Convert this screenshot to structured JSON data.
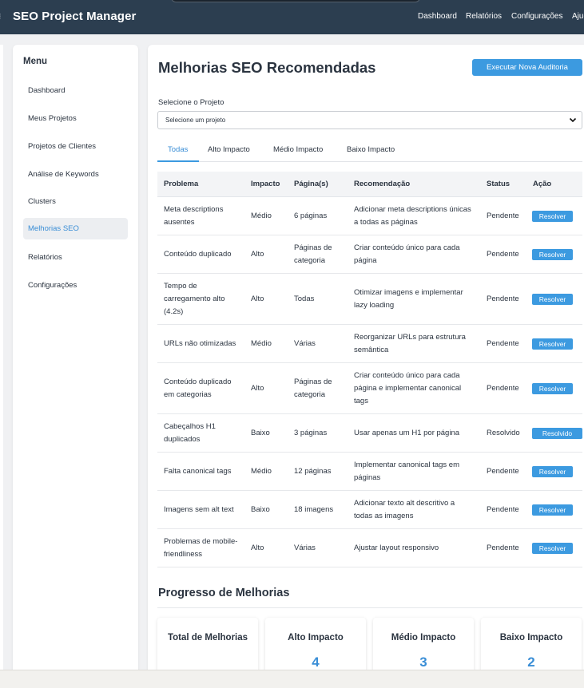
{
  "topbar": {
    "brand": "SEO Project Manager",
    "nav": [
      "Dashboard",
      "Relatórios",
      "Configurações",
      "Ajuda"
    ]
  },
  "sidebar": {
    "title": "Menu",
    "items": [
      {
        "label": "Dashboard"
      },
      {
        "label": "Meus Projetos"
      },
      {
        "label": "Projetos de Clientes"
      },
      {
        "label": "Análise de Keywords"
      },
      {
        "label": "Clusters"
      },
      {
        "label": "Melhorias SEO"
      },
      {
        "label": "Relatórios"
      },
      {
        "label": "Configurações"
      }
    ],
    "active_index": 5
  },
  "main": {
    "title": "Melhorias SEO Recomendadas",
    "run_audit_label": "Executar Nova Auditoria",
    "project_select": {
      "label": "Selecione o Projeto",
      "value": "Selecione um projeto"
    },
    "tabs": [
      "Todas",
      "Alto Impacto",
      "Médio Impacto",
      "Baixo Impacto"
    ],
    "active_tab": 0,
    "table": {
      "headers": [
        "Problema",
        "Impacto",
        "Página(s)",
        "Recomendação",
        "Status",
        "Ação"
      ],
      "rows": [
        {
          "problem": "Meta descriptions ausentes",
          "impact": "Médio",
          "pages": "6 páginas",
          "recommendation": "Adicionar meta descriptions únicas a todas as páginas",
          "status": "Pendente",
          "action": "Resolver"
        },
        {
          "problem": "Conteúdo duplicado",
          "impact": "Alto",
          "pages": "Páginas de categoria",
          "recommendation": "Criar conteúdo único para cada página",
          "status": "Pendente",
          "action": "Resolver"
        },
        {
          "problem": "Tempo de carregamento alto (4.2s)",
          "impact": "Alto",
          "pages": "Todas",
          "recommendation": "Otimizar imagens e implementar lazy loading",
          "status": "Pendente",
          "action": "Resolver"
        },
        {
          "problem": "URLs não otimizadas",
          "impact": "Médio",
          "pages": "Várias",
          "recommendation": "Reorganizar URLs para estrutura semântica",
          "status": "Pendente",
          "action": "Resolver"
        },
        {
          "problem": "Conteúdo duplicado em categorias",
          "impact": "Alto",
          "pages": "Páginas de categoria",
          "recommendation": "Criar conteúdo único para cada página e implementar canonical tags",
          "status": "Pendente",
          "action": "Resolver"
        },
        {
          "problem": "Cabeçalhos H1 duplicados",
          "impact": "Baixo",
          "pages": "3 páginas",
          "recommendation": "Usar apenas um H1 por página",
          "status": "Resolvido",
          "action": "Resolvido"
        },
        {
          "problem": "Falta canonical tags",
          "impact": "Médio",
          "pages": "12 páginas",
          "recommendation": "Implementar canonical tags em páginas",
          "status": "Pendente",
          "action": "Resolver"
        },
        {
          "problem": "Imagens sem alt text",
          "impact": "Baixo",
          "pages": "18 imagens",
          "recommendation": "Adicionar texto alt descritivo a todas as imagens",
          "status": "Pendente",
          "action": "Resolver"
        },
        {
          "problem": "Problemas de mobile-friendliness",
          "impact": "Alto",
          "pages": "Várias",
          "recommendation": "Ajustar layout responsivo",
          "status": "Pendente",
          "action": "Resolver"
        }
      ]
    },
    "progress": {
      "title": "Progresso de Melhorias",
      "cards": [
        {
          "label": "Total de Melhorias",
          "value": ""
        },
        {
          "label": "Alto Impacto",
          "value": "4"
        },
        {
          "label": "Médio Impacto",
          "value": "3"
        },
        {
          "label": "Baixo Impacto",
          "value": "2"
        }
      ]
    }
  },
  "colors": {
    "nav_bg": "#2c3e50",
    "accent": "#3c9ae0",
    "active_text": "#3a8ed6"
  }
}
